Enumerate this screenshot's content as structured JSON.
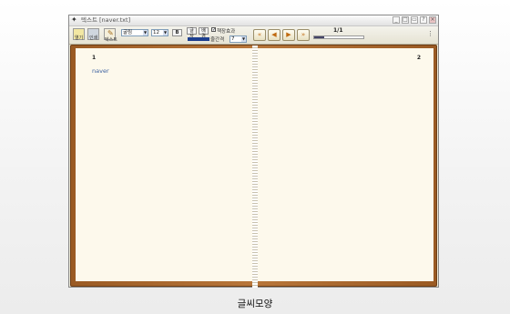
{
  "window": {
    "title": "텍스트 [naver.txt]",
    "controls": [
      "_",
      "□",
      "▭",
      "?",
      "×"
    ]
  },
  "toolbar": {
    "open_label": "열기",
    "print_label": "인쇄",
    "edit_label": "텍스트",
    "font_name": "굴림",
    "font_size": "12",
    "bold_label": "B",
    "color_label": "글자",
    "bg_label": "배경",
    "effect_checkbox_label": "책장효과",
    "effect_checked": true,
    "spacing_label": "줄간격",
    "spacing_value": "7",
    "page_counter": "1/1",
    "progress": 0.2,
    "nav": [
      "first-page",
      "prev-page",
      "next-page",
      "last-page"
    ]
  },
  "book": {
    "left_page_number": "1",
    "right_page_number": "2",
    "left_page_text": "naver"
  },
  "caption": "글씨모양",
  "colors": {
    "book_cover": "#a8662c",
    "page": "#fdf9ec",
    "text_link": "#3a5f9f",
    "nav_arrow": "#c06a10"
  }
}
